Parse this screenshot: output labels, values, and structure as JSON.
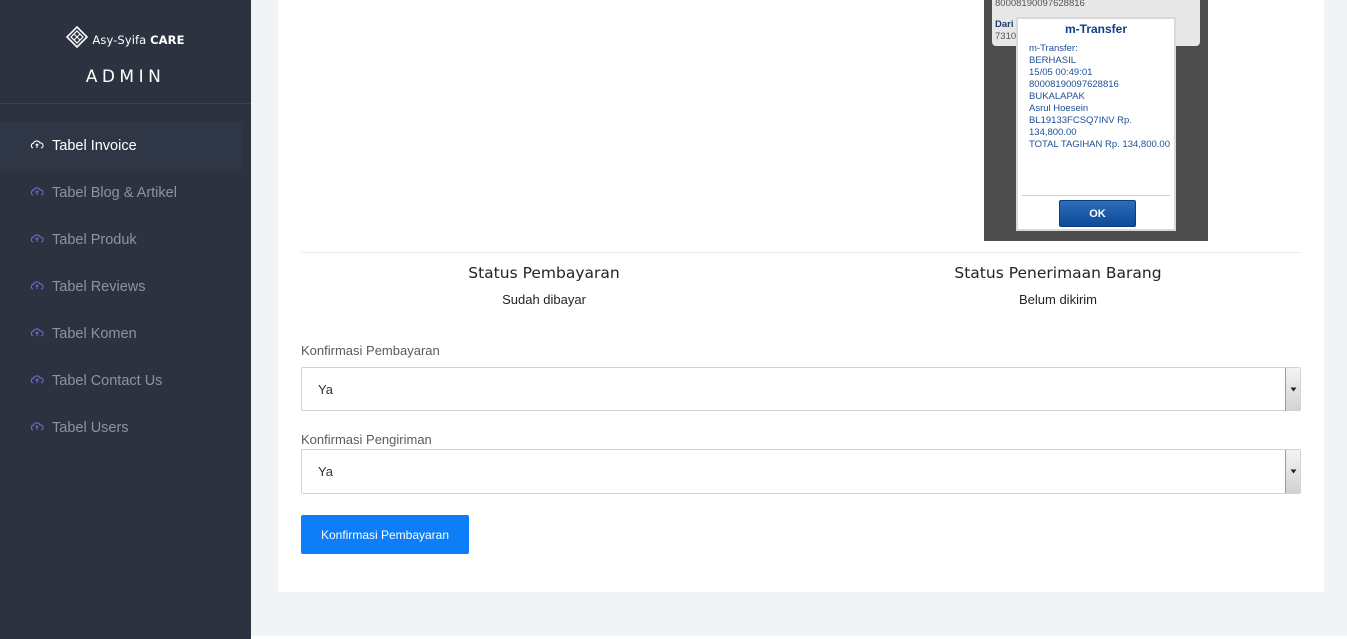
{
  "brand": {
    "logo_text_light": "Asy-Syifa",
    "logo_text_bold": "CARE",
    "panel_title": "ADMIN"
  },
  "sidebar": {
    "items": [
      {
        "label": "Tabel Invoice",
        "active": true
      },
      {
        "label": "Tabel Blog & Artikel",
        "active": false
      },
      {
        "label": "Tabel Produk",
        "active": false
      },
      {
        "label": "Tabel Reviews",
        "active": false
      },
      {
        "label": "Tabel Komen",
        "active": false
      },
      {
        "label": "Tabel Contact Us",
        "active": false
      },
      {
        "label": "Tabel Users",
        "active": false
      }
    ]
  },
  "receipt": {
    "bg_line1": "80008190097628816",
    "bg_line2": "Dari I",
    "bg_line3": "7310",
    "dialog_title": "m-Transfer",
    "dialog_body": "m-Transfer:\nBERHASIL\n15/05 00:49:01\n80008190097628816\nBUKALAPAK\nAsrul Hoesein\nBL19133FCSQ7INV Rp.\n134,800.00\nTOTAL TAGIHAN Rp. 134,800.00",
    "ok_label": "OK"
  },
  "status": {
    "payment_title": "Status Pembayaran",
    "payment_value": "Sudah dibayar",
    "shipping_title": "Status Penerimaan Barang",
    "shipping_value": "Belum dikirim"
  },
  "form": {
    "payment_confirm_label": "Konfirmasi Pembayaran",
    "payment_confirm_value": "Ya",
    "shipping_confirm_label": "Konfirmasi Pengiriman",
    "shipping_confirm_value": "Ya",
    "submit_label": "Konfirmasi Pembayaran"
  },
  "colors": {
    "sidebar_bg": "#2c3240",
    "primary": "#0d7ef7",
    "page_bg": "#f1f4f6"
  }
}
